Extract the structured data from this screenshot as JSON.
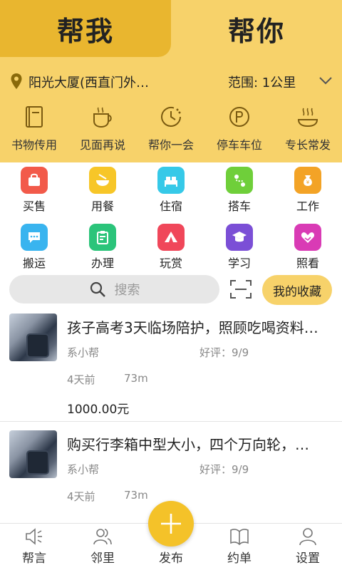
{
  "tabs": {
    "left": "帮我",
    "right": "帮你"
  },
  "location": {
    "text": "阳光大厦(西直门外…",
    "range": "范围: 1公里"
  },
  "categories": [
    {
      "label": "书物传用",
      "icon": "book-icon"
    },
    {
      "label": "见面再说",
      "icon": "coffee-icon"
    },
    {
      "label": "帮你一会",
      "icon": "clock-icon"
    },
    {
      "label": "停车车位",
      "icon": "parking-icon"
    },
    {
      "label": "专长常发",
      "icon": "hot-dish-icon"
    }
  ],
  "grid_row1": [
    {
      "label": "买售",
      "icon": "shop-icon",
      "color": "#f25a4a"
    },
    {
      "label": "用餐",
      "icon": "bowl-icon",
      "color": "#f7c628"
    },
    {
      "label": "住宿",
      "icon": "bed-icon",
      "color": "#36c9e8"
    },
    {
      "label": "搭车",
      "icon": "route-icon",
      "color": "#6fcf3a"
    },
    {
      "label": "工作",
      "icon": "money-bag-icon",
      "color": "#f3a326"
    }
  ],
  "grid_row2": [
    {
      "label": "搬运",
      "icon": "chat-icon",
      "color": "#39b4ef"
    },
    {
      "label": "办理",
      "icon": "clipboard-icon",
      "color": "#2bc47a"
    },
    {
      "label": "玩赏",
      "icon": "tent-icon",
      "color": "#f0475a"
    },
    {
      "label": "学习",
      "icon": "graduation-icon",
      "color": "#7b4fd6"
    },
    {
      "label": "照看",
      "icon": "heart-hand-icon",
      "color": "#d93bb5"
    }
  ],
  "search": {
    "placeholder": "搜索",
    "favorites": "我的收藏"
  },
  "listings": [
    {
      "title": "孩子高考3天临场陪护，照顾吃喝资料…",
      "poster": "系小帮",
      "rating": "好评：9/9",
      "time": "4天前",
      "distance": "73m",
      "price": "1000.00元"
    },
    {
      "title": "购买行李箱中型大小，四个万向轮，…",
      "poster": "系小帮",
      "rating": "好评：9/9",
      "time": "4天前",
      "distance": "73m",
      "price": ""
    }
  ],
  "nav": [
    {
      "label": "帮言",
      "icon": "speaker-icon"
    },
    {
      "label": "邻里",
      "icon": "people-icon"
    },
    {
      "label": "发布",
      "icon": "plus-icon"
    },
    {
      "label": "约单",
      "icon": "open-book-icon"
    },
    {
      "label": "设置",
      "icon": "user-icon"
    }
  ],
  "colors": {
    "header": "#f7d26a",
    "active_tab": "#e9b62f",
    "fab": "#f4c229"
  }
}
